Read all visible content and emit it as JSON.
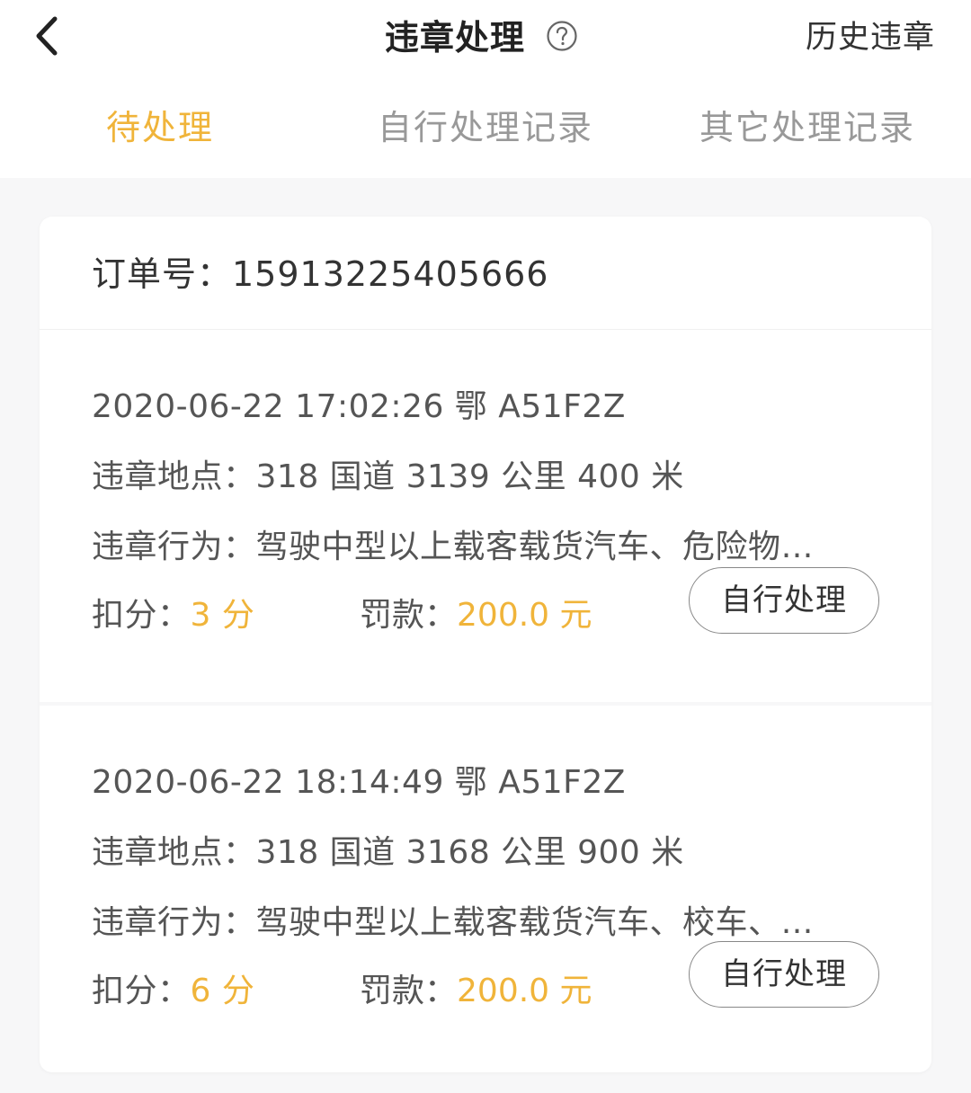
{
  "header": {
    "title": "违章处理",
    "help_icon": "question-circle-icon",
    "history_label": "历史违章"
  },
  "tabs": [
    {
      "label": "待处理",
      "active": true
    },
    {
      "label": "自行处理记录",
      "active": false
    },
    {
      "label": "其它处理记录",
      "active": false
    }
  ],
  "order": {
    "label": "订单号：15913225405666"
  },
  "violations": [
    {
      "time_plate": "2020-06-22 17:02:26 鄂 A51F2Z",
      "place_label": "违章地点：",
      "place": "318 国道 3139 公里 400 米",
      "behavior_label": "违章行为：",
      "behavior": "驾驶中型以上载客载货汽车、危险物…",
      "score_label": "扣分：",
      "score": "3 分",
      "fine_label": "罚款：",
      "fine": "200.0 元",
      "action_label": "自行处理"
    },
    {
      "time_plate": "2020-06-22 18:14:49 鄂 A51F2Z",
      "place_label": "违章地点：",
      "place": "318 国道 3168 公里 900 米",
      "behavior_label": "违章行为：",
      "behavior": "驾驶中型以上载客载货汽车、校车、…",
      "score_label": "扣分：",
      "score": "6 分",
      "fine_label": "罚款：",
      "fine": "200.0 元",
      "action_label": "自行处理"
    }
  ],
  "colors": {
    "accent": "#f0b43a",
    "inactive_tab": "#999999",
    "background": "#f7f7f8"
  }
}
